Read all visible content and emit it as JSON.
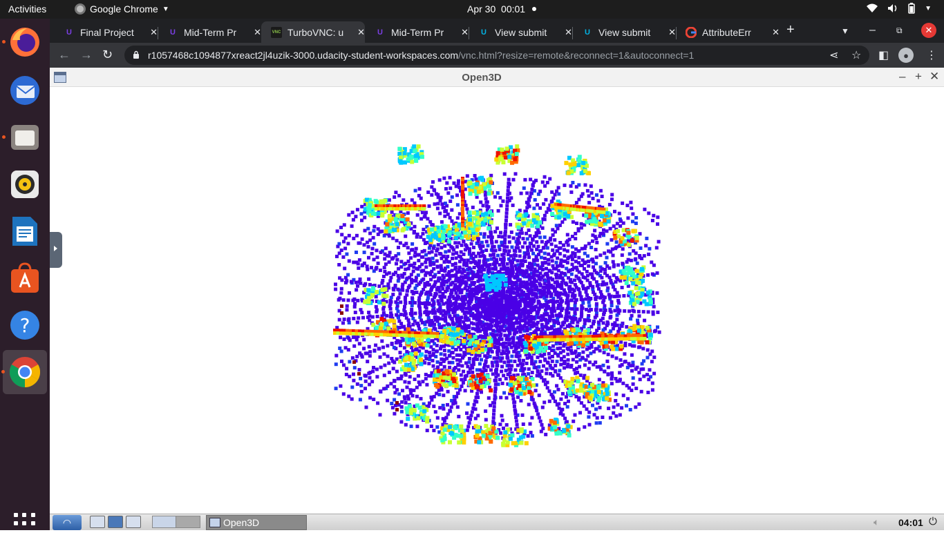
{
  "topbar": {
    "activities": "Activities",
    "app_name": "Google Chrome",
    "date": "Apr 30",
    "time": "00:01"
  },
  "dock": {
    "apps": [
      "firefox-icon",
      "thunderbird-icon",
      "files-icon",
      "rhythmbox-icon",
      "libreoffice-writer-icon",
      "ubuntu-software-icon",
      "help-icon",
      "chrome-icon"
    ],
    "running": [
      "firefox-icon",
      "files-icon",
      "chrome-icon"
    ]
  },
  "tabs": [
    {
      "title": "Final Project",
      "favicon": "udacity",
      "active": false
    },
    {
      "title": "Mid-Term Pr",
      "favicon": "udacity",
      "active": false
    },
    {
      "title": "TurboVNC: u",
      "favicon": "vnc",
      "active": true
    },
    {
      "title": "Mid-Term Pr",
      "favicon": "udacity",
      "active": false
    },
    {
      "title": "View submit",
      "favicon": "udacity-blue",
      "active": false
    },
    {
      "title": "View submit",
      "favicon": "udacity-blue",
      "active": false
    },
    {
      "title": "AttributeErr",
      "favicon": "google",
      "active": false
    }
  ],
  "address_bar": {
    "host": "r1057468c1094877xreact2jl4uzik-3000.udacity-student-workspaces.com",
    "path": "/vnc.html?resize=remote&reconnect=1&autoconnect=1"
  },
  "vnc_window": {
    "title": "Open3D"
  },
  "panel": {
    "task_label": "Open3D",
    "clock": "04:01"
  },
  "colors": {
    "point_palette": [
      "#4a00e6",
      "#1f3cf0",
      "#00c8ff",
      "#33ffc8",
      "#c8ff33",
      "#ffd000",
      "#ff6a00",
      "#ee1100",
      "#8b0000"
    ]
  }
}
